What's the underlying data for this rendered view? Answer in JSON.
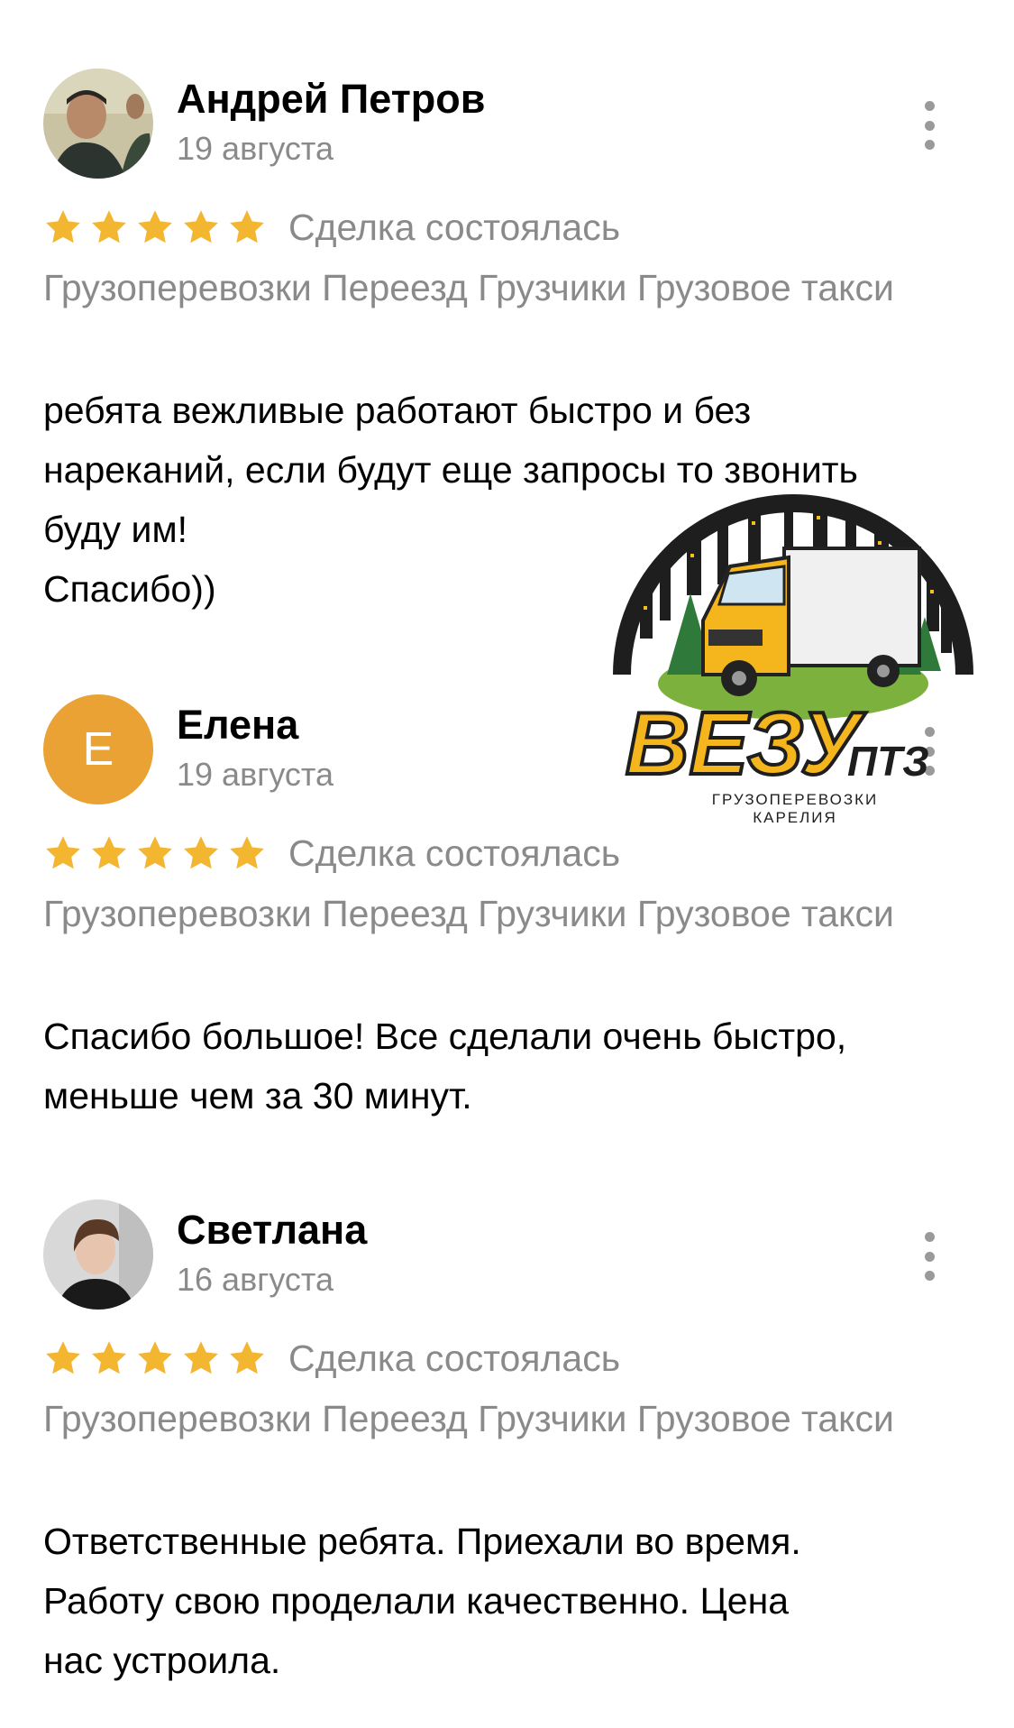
{
  "reviews": [
    {
      "name": "Андрей Петров",
      "date": "19 августа",
      "rating": 5,
      "deal_status": "Сделка состоялась",
      "tags": "Грузоперевозки Переезд Грузчики Грузовое такси",
      "text_lines": [
        "ребята вежливые работают быстро и без",
        "нареканий, если будут еще запросы то звонить",
        "буду им!",
        "Спасибо))"
      ]
    },
    {
      "name": "Елена",
      "avatar_letter": "Е",
      "date": "19 августа",
      "rating": 5,
      "deal_status": "Сделка состоялась",
      "tags": "Грузоперевозки Переезд Грузчики Грузовое такси",
      "text_lines": [
        "Спасибо большое! Все сделали очень быстро,",
        "меньше чем за 30 минут."
      ]
    },
    {
      "name": "Светлана",
      "date": "16 августа",
      "rating": 5,
      "deal_status": "Сделка состоялась",
      "tags": "Грузоперевозки Переезд Грузчики Грузовое такси",
      "text_lines": [
        "Ответственные ребята. Приехали во время.",
        "Работу свою проделали качественно. Цена",
        "нас устроила."
      ]
    }
  ],
  "logo": {
    "brand": "ВЕЗУ",
    "brand_suffix": "ПТЗ",
    "subtitle_line1": "ГРУЗОПЕРЕВОЗКИ",
    "subtitle_line2": "КАРЕЛИЯ"
  },
  "colors": {
    "star": "#f2b631",
    "muted_text": "#8a8a8a",
    "avatar_elena": "#e9a233",
    "menu_dots": "#9a9a9a"
  }
}
